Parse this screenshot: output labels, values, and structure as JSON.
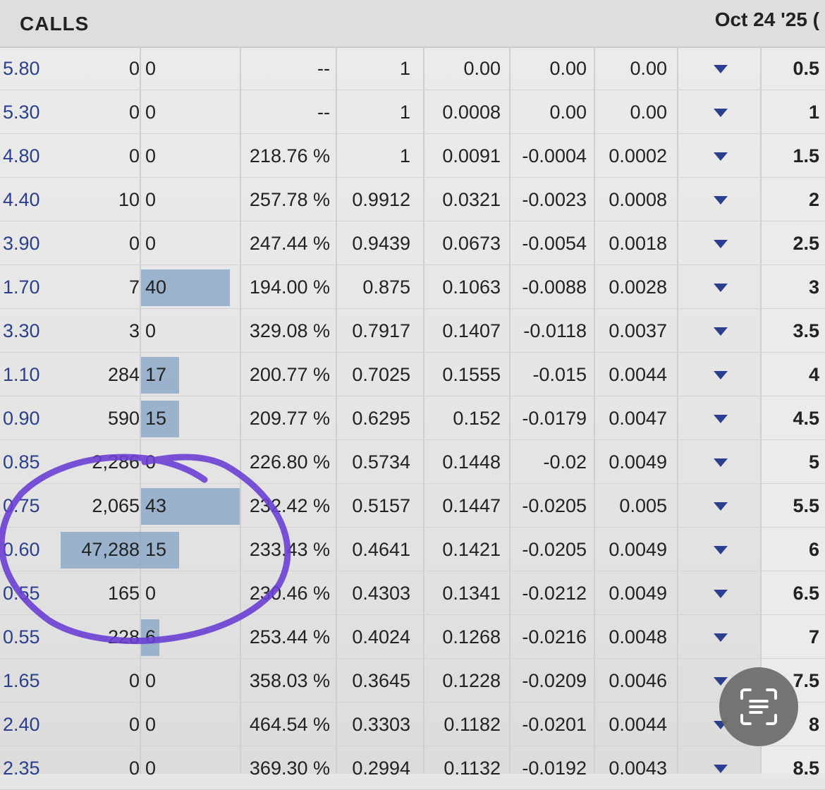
{
  "header": {
    "title": "CALLS",
    "expiration": "Oct 24 '25 ("
  },
  "rows": [
    {
      "price": "5.80",
      "volume": "0",
      "oi": "0",
      "iv": "--",
      "delta": "1",
      "gamma": "0.00",
      "theta": "0.00",
      "vega": "0.00",
      "strike": "0.5"
    },
    {
      "price": "5.30",
      "volume": "0",
      "oi": "0",
      "iv": "--",
      "delta": "1",
      "gamma": "0.0008",
      "theta": "0.00",
      "vega": "0.00",
      "strike": "1"
    },
    {
      "price": "4.80",
      "volume": "0",
      "oi": "0",
      "iv": "218.76 %",
      "delta": "1",
      "gamma": "0.0091",
      "theta": "-0.0004",
      "vega": "0.0002",
      "strike": "1.5"
    },
    {
      "price": "4.40",
      "volume": "10",
      "oi": "0",
      "iv": "257.78 %",
      "delta": "0.9912",
      "gamma": "0.0321",
      "theta": "-0.0023",
      "vega": "0.0008",
      "strike": "2"
    },
    {
      "price": "3.90",
      "volume": "0",
      "oi": "0",
      "iv": "247.44 %",
      "delta": "0.9439",
      "gamma": "0.0673",
      "theta": "-0.0054",
      "vega": "0.0018",
      "strike": "2.5"
    },
    {
      "price": "1.70",
      "volume": "7",
      "oi": "40",
      "iv": "194.00 %",
      "delta": "0.875",
      "gamma": "0.1063",
      "theta": "-0.0088",
      "vega": "0.0028",
      "strike": "3"
    },
    {
      "price": "3.30",
      "volume": "3",
      "oi": "0",
      "iv": "329.08 %",
      "delta": "0.7917",
      "gamma": "0.1407",
      "theta": "-0.0118",
      "vega": "0.0037",
      "strike": "3.5"
    },
    {
      "price": "1.10",
      "volume": "284",
      "oi": "17",
      "iv": "200.77 %",
      "delta": "0.7025",
      "gamma": "0.1555",
      "theta": "-0.015",
      "vega": "0.0044",
      "strike": "4"
    },
    {
      "price": "0.90",
      "volume": "590",
      "oi": "15",
      "iv": "209.77 %",
      "delta": "0.6295",
      "gamma": "0.152",
      "theta": "-0.0179",
      "vega": "0.0047",
      "strike": "4.5"
    },
    {
      "price": "0.85",
      "volume": "2,286",
      "oi": "0",
      "iv": "226.80 %",
      "delta": "0.5734",
      "gamma": "0.1448",
      "theta": "-0.02",
      "vega": "0.0049",
      "strike": "5"
    },
    {
      "price": "0.75",
      "volume": "2,065",
      "oi": "43",
      "iv": "232.42 %",
      "delta": "0.5157",
      "gamma": "0.1447",
      "theta": "-0.0205",
      "vega": "0.005",
      "strike": "5.5"
    },
    {
      "price": "0.60",
      "volume": "47,288",
      "oi": "15",
      "iv": "233.43 %",
      "delta": "0.4641",
      "gamma": "0.1421",
      "theta": "-0.0205",
      "vega": "0.0049",
      "strike": "6"
    },
    {
      "price": "0.55",
      "volume": "165",
      "oi": "0",
      "iv": "230.46 %",
      "delta": "0.4303",
      "gamma": "0.1341",
      "theta": "-0.0212",
      "vega": "0.0049",
      "strike": "6.5"
    },
    {
      "price": "0.55",
      "volume": "228",
      "oi": "6",
      "iv": "253.44 %",
      "delta": "0.4024",
      "gamma": "0.1268",
      "theta": "-0.0216",
      "vega": "0.0048",
      "strike": "7"
    },
    {
      "price": "1.65",
      "volume": "0",
      "oi": "0",
      "iv": "358.03 %",
      "delta": "0.3645",
      "gamma": "0.1228",
      "theta": "-0.0209",
      "vega": "0.0046",
      "strike": "7.5"
    },
    {
      "price": "2.40",
      "volume": "0",
      "oi": "0",
      "iv": "464.54 %",
      "delta": "0.3303",
      "gamma": "0.1182",
      "theta": "-0.0201",
      "vega": "0.0044",
      "strike": "8"
    },
    {
      "price": "2.35",
      "volume": "0",
      "oi": "0",
      "iv": "369.30 %",
      "delta": "0.2994",
      "gamma": "0.1132",
      "theta": "-0.0192",
      "vega": "0.0043",
      "strike": "8.5"
    }
  ],
  "icons": {
    "row_expand": "chevron-down-icon",
    "lens": "text-scan-icon"
  },
  "colors": {
    "price_text": "#2b3f8e",
    "volume_bar": "#8ea9c8",
    "annotation_circle": "#6a3fd4"
  }
}
